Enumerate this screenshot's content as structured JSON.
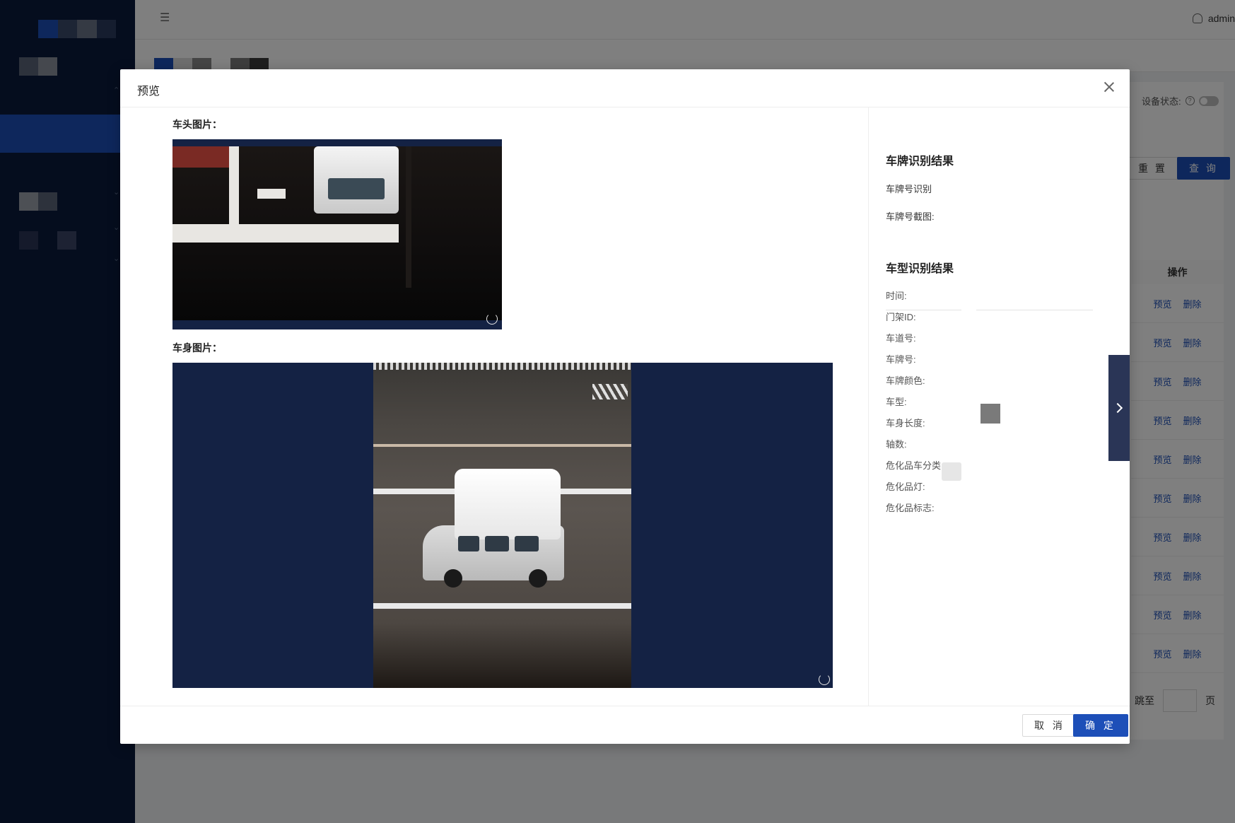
{
  "header": {
    "user_name": "admin"
  },
  "toolbar": {
    "device_status_label": "设备状态:",
    "reset_label": "重 置",
    "search_label": "查 询"
  },
  "table": {
    "op_header": "操作",
    "row_actions": [
      {
        "preview": "预览",
        "delete": "删除"
      },
      {
        "preview": "预览",
        "delete": "删除"
      },
      {
        "preview": "预览",
        "delete": "删除"
      },
      {
        "preview": "预览",
        "delete": "删除"
      },
      {
        "preview": "预览",
        "delete": "删除"
      },
      {
        "preview": "预览",
        "delete": "删除"
      },
      {
        "preview": "预览",
        "delete": "删除"
      },
      {
        "preview": "预览",
        "delete": "删除"
      },
      {
        "preview": "预览",
        "delete": "删除"
      },
      {
        "preview": "预览",
        "delete": "删除"
      }
    ]
  },
  "pagination": {
    "jump_label": "跳至",
    "page_suffix": "页"
  },
  "modal": {
    "title": "预览",
    "front_image_label": "车头图片：",
    "body_image_label": "车身图片：",
    "plate_section_title": "车牌识别结果",
    "plate_number_label": "车牌号识别",
    "plate_crop_label": "车牌号截图:",
    "vehicle_section_title": "车型识别结果",
    "fields": [
      "时间:",
      "门架ID:",
      "车道号:",
      "车牌号:",
      "车牌颜色:",
      "车型:",
      "车身长度:",
      "轴数:",
      "危化品车分类",
      "危化品灯:",
      "危化品标志:"
    ],
    "cancel_label": "取 消",
    "ok_label": "确 定"
  },
  "colors": {
    "sidebar_bg": "#0a1a3c",
    "primary": "#1d4fb8",
    "image_bg": "#142244"
  }
}
